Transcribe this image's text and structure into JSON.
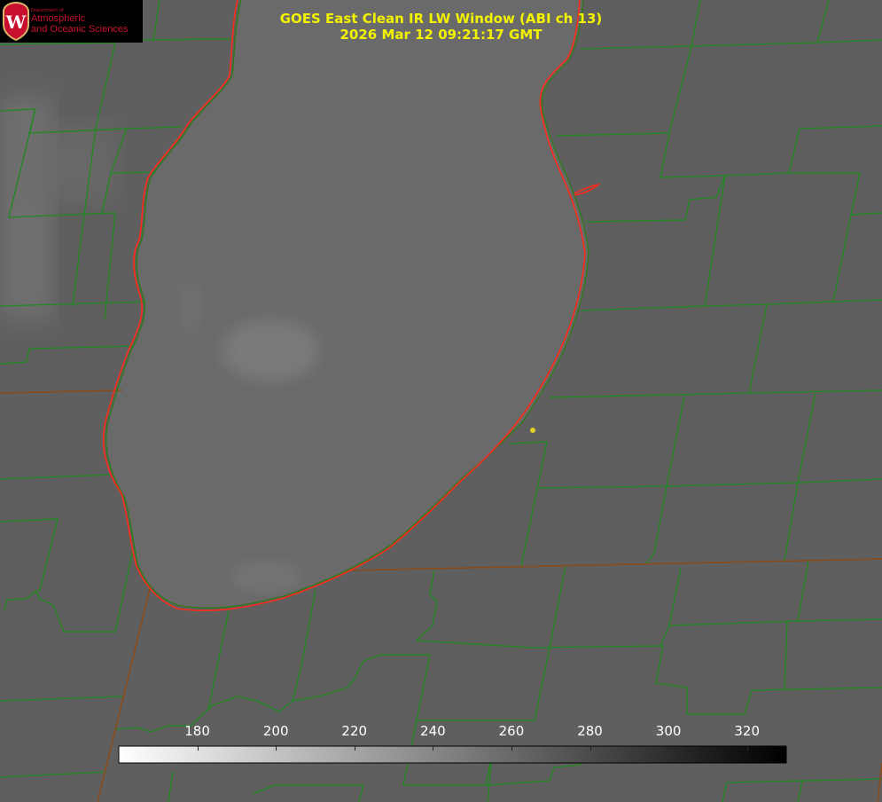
{
  "title": {
    "line1": "GOES East Clean IR LW Window (ABI ch 13)",
    "line2": "2026 Mar 12 09:21:17 GMT"
  },
  "logo": {
    "org_small": "Department of",
    "org_line1": "Atmospheric",
    "org_line2": "and Oceanic Sciences",
    "crest_letter": "W"
  },
  "colorbar": {
    "min": 160,
    "max": 330,
    "gradient": [
      "#ffffff",
      "#000000"
    ],
    "ticks": [
      {
        "value": 180,
        "label": "180"
      },
      {
        "value": 200,
        "label": "200"
      },
      {
        "value": 220,
        "label": "220"
      },
      {
        "value": 240,
        "label": "240"
      },
      {
        "value": 260,
        "label": "260"
      },
      {
        "value": 280,
        "label": "280"
      },
      {
        "value": 300,
        "label": "300"
      },
      {
        "value": 320,
        "label": "320"
      }
    ]
  },
  "colors": {
    "background": "#5f5f5f",
    "lake": "#6a6a6a",
    "county_lines": "#1f8a1f",
    "state_lines": "#8a4b1a",
    "coastline": "#ff2a1a",
    "title_text": "#f3f300",
    "marker": "#e0d020"
  },
  "icons": [
    "uw-crest-icon",
    "location-marker-icon"
  ]
}
